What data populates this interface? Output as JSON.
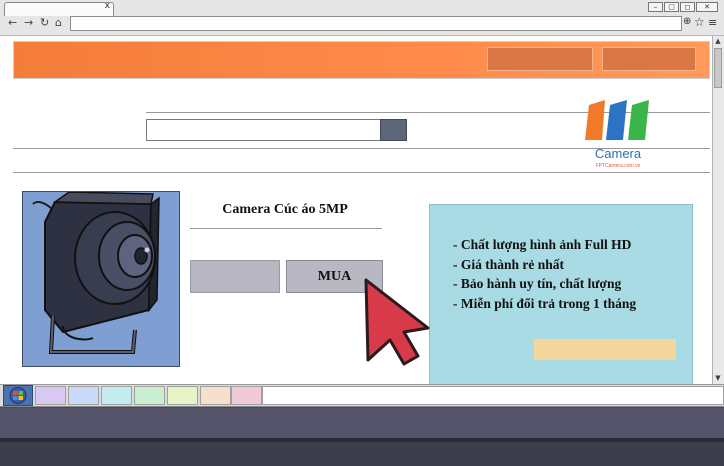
{
  "product": {
    "title": "Camera Cúc áo 5MP",
    "buy_label": "MUA"
  },
  "logo": {
    "text": "Camera",
    "subtext": "FPTCamera.com.vn",
    "colors": [
      "#f07a2a",
      "#2d73c4",
      "#3ab54a"
    ]
  },
  "features": [
    "- Chất lượng hình ảnh Full HD",
    "- Giá thành rẻ nhất",
    "- Bảo hành uy tín, chất lượng",
    "- Miễn phí đổi trả trong 1 tháng"
  ],
  "colors": {
    "banner": "#f57d3a",
    "feature_box": "#a8dbe3",
    "cursor": "#d83a4a"
  },
  "taskbar": {
    "swatches": [
      "#d9c9f2",
      "#c9d9f7",
      "#c4ecf0",
      "#c8f0d0",
      "#e6f3c6",
      "#f7dfce",
      "#f2c9d6"
    ]
  }
}
